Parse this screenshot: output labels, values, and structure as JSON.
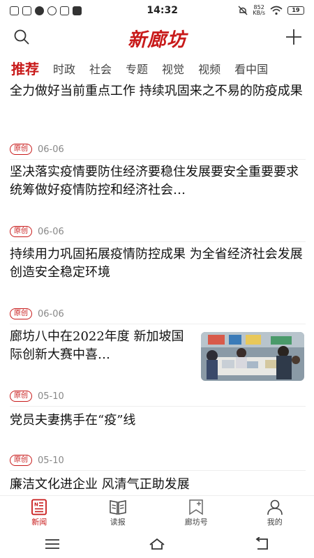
{
  "status_bar": {
    "time": "14:32",
    "net_speed": "852",
    "net_unit": "KB/s",
    "battery": "19"
  },
  "header": {
    "logo": "新廊坊"
  },
  "tabs": [
    {
      "label": "推荐",
      "active": true
    },
    {
      "label": "时政"
    },
    {
      "label": "社会"
    },
    {
      "label": "专题"
    },
    {
      "label": "视觉"
    },
    {
      "label": "视频"
    },
    {
      "label": "看中国"
    }
  ],
  "articles": [
    {
      "title": "全力做好当前重点工作 持续巩固来之不易的防疫成果",
      "badge": "原创",
      "date": "06-06"
    },
    {
      "title": "坚决落实疫情要防住经济要稳住发展要安全重要要求 统筹做好疫情防控和经济社会…",
      "badge": "原创",
      "date": "06-06"
    },
    {
      "title": "持续用力巩固拓展疫情防控成果 为全省经济社会发展创造安全稳定环境",
      "badge": "原创",
      "date": "06-06"
    },
    {
      "title": "廊坊八中在2022年度 新加坡国际创新大赛中喜…",
      "badge": "原创",
      "date": "05-10",
      "has_image": true
    },
    {
      "title": "党员夫妻携手在“疫”线",
      "badge": "原创",
      "date": "05-10"
    },
    {
      "title": "廉洁文化进企业 风清气正助发展"
    }
  ],
  "bottom_nav": [
    {
      "label": "新闻",
      "icon": "news-icon",
      "active": true
    },
    {
      "label": "读报",
      "icon": "newspaper-icon"
    },
    {
      "label": "廊坊号",
      "icon": "bookmark-add-icon"
    },
    {
      "label": "我的",
      "icon": "user-icon"
    }
  ],
  "colors": {
    "accent": "#c81a1a",
    "meta_gray": "#888888",
    "divider": "#eeeeee"
  }
}
